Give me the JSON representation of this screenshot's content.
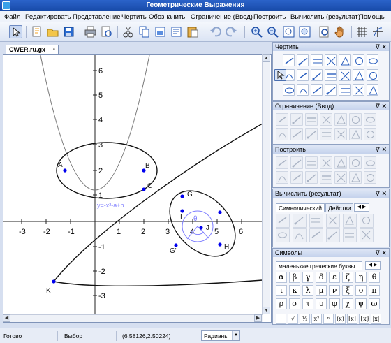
{
  "window": {
    "title": "Геометрические Выражения"
  },
  "menu": [
    "Файл",
    "Редактировать",
    "Представление",
    "Чертить",
    "Обозначить",
    "Ограничение (Ввод)",
    "Построить",
    "Вычислить (результат)",
    "Помощь"
  ],
  "document": {
    "tab": "CWER.ru.gx",
    "close": "×"
  },
  "axes": {
    "x_ticks": [
      "-3",
      "-2",
      "-1",
      "1",
      "2",
      "3",
      "4",
      "5",
      "6"
    ],
    "y_ticks": [
      "6",
      "5",
      "4",
      "3",
      "2",
      "1",
      "-1",
      "-2",
      "-3"
    ]
  },
  "canvas": {
    "points": [
      "A",
      "B",
      "C",
      "G",
      "I",
      "J",
      "H",
      "G'",
      "K"
    ],
    "theta": "θ",
    "curve_label": "y=-x²-a+b"
  },
  "panels": {
    "draw": {
      "title": "Чертить"
    },
    "constraint": {
      "title": "Ограничение (Ввод)"
    },
    "construct": {
      "title": "Построить"
    },
    "calculate": {
      "title": "Вычислить (результат)",
      "tabs": [
        "Символический",
        "Действи"
      ]
    },
    "symbols": {
      "title": "Символы",
      "category": "маленькие греческие буквы",
      "letters": [
        "α",
        "β",
        "γ",
        "δ",
        "ε",
        "ζ",
        "η",
        "θ",
        "ι",
        "κ",
        "λ",
        "μ",
        "ν",
        "ξ",
        "ο",
        "π",
        "ρ",
        "σ",
        "τ",
        "υ",
        "φ",
        "χ",
        "ψ",
        "ω"
      ],
      "extras": [
        "·",
        "√",
        "½",
        "x²",
        "ⁿ",
        "(x)",
        "[x]",
        "{x}",
        "|x|"
      ]
    },
    "pin_close": "ᐁ ✕"
  },
  "status": {
    "ready": "Готово",
    "mode": "Выбор",
    "coords": "(6.58126,2.50224)",
    "units": "Радианы"
  },
  "colors": {
    "accent": "#1f56b8",
    "point": "#0000ee",
    "construct": "#7f7fff"
  }
}
